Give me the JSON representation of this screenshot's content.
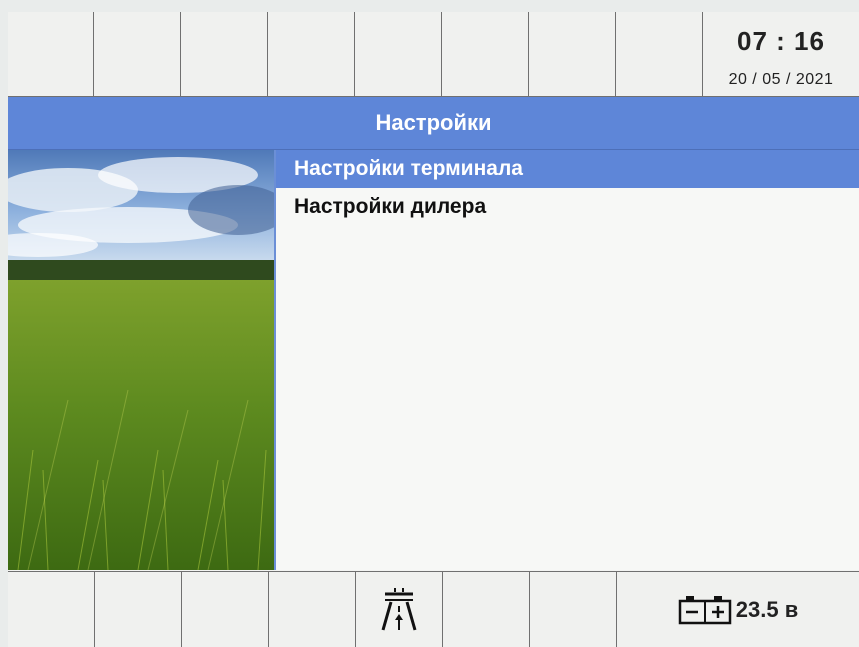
{
  "status": {
    "time": "07 : 16",
    "date": "20 / 05 / 2021"
  },
  "header": {
    "title": "Настройки"
  },
  "menu": {
    "items": [
      {
        "label": "Настройки терминала",
        "selected": true
      },
      {
        "label": "Настройки дилера",
        "selected": false
      }
    ]
  },
  "footer": {
    "battery_voltage": "23.5 в",
    "road_icon": "road-lane-icon",
    "battery_icon": "battery-icon"
  },
  "colors": {
    "accent": "#5e86d8",
    "background": "#f3f4f2"
  }
}
